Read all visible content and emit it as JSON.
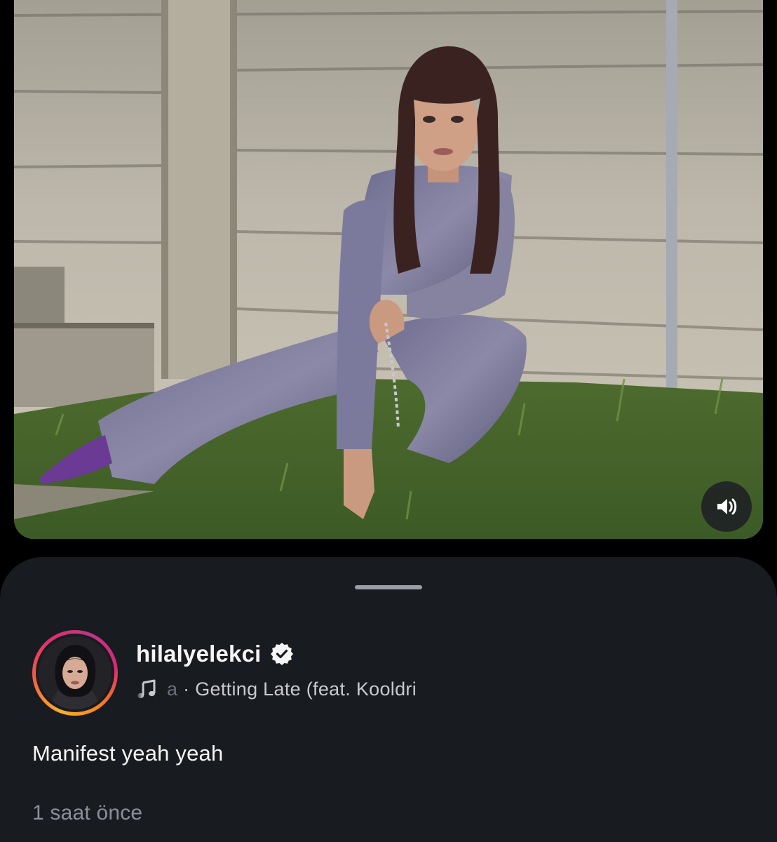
{
  "post": {
    "username": "hilalyelekci",
    "verified": true,
    "music": {
      "artist_fragment": "a",
      "separator": " · ",
      "track": "Getting Late (feat. Kooldri"
    },
    "caption": "Manifest yeah yeah",
    "timestamp": "1 saat önce"
  },
  "icons": {
    "mute": "speaker-volume-icon",
    "verified": "verified-badge-icon",
    "music": "music-note-icon"
  },
  "colors": {
    "sheet_background": "#181b20",
    "story_ring": [
      "#f9b128",
      "#f56040",
      "#e1306c",
      "#c13584"
    ],
    "primary_text": "#f5f5f5",
    "secondary_text": "#8b8f97"
  }
}
